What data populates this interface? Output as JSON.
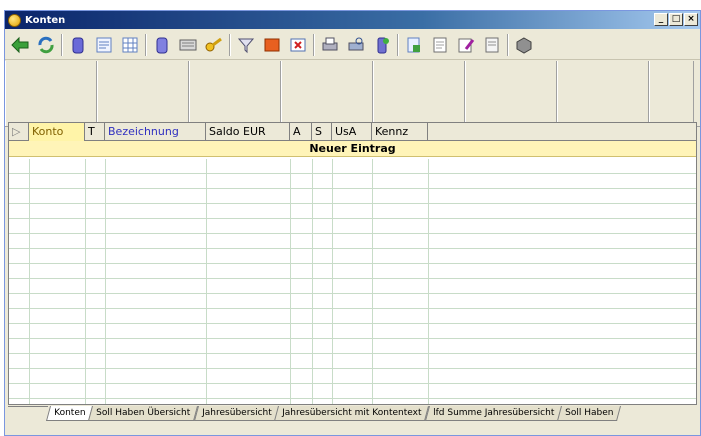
{
  "window": {
    "title": "Konten"
  },
  "window_buttons": [
    "_",
    "□",
    "×"
  ],
  "grid": {
    "columns": [
      {
        "label": "▷"
      },
      {
        "label": "Konto"
      },
      {
        "label": "T"
      },
      {
        "label": "Bezeichnung"
      },
      {
        "label": "Saldo EUR"
      },
      {
        "label": "A"
      },
      {
        "label": "S"
      },
      {
        "label": "UsA"
      },
      {
        "label": "Kennz"
      }
    ],
    "new_row_label": "Neuer Eintrag"
  },
  "tabs": [
    {
      "label": "Konten"
    },
    {
      "label": "Soll Haben Übersicht"
    },
    {
      "label": "Jahresübersicht"
    },
    {
      "label": "Jahresübersicht mit Kontentext"
    },
    {
      "label": "lfd Summe Jahresübersicht"
    },
    {
      "label": "Soll Haben"
    }
  ],
  "colors": {
    "accent": "#0a246a",
    "new_row": "#fff4b8",
    "konto_header": "#fff4a8"
  }
}
